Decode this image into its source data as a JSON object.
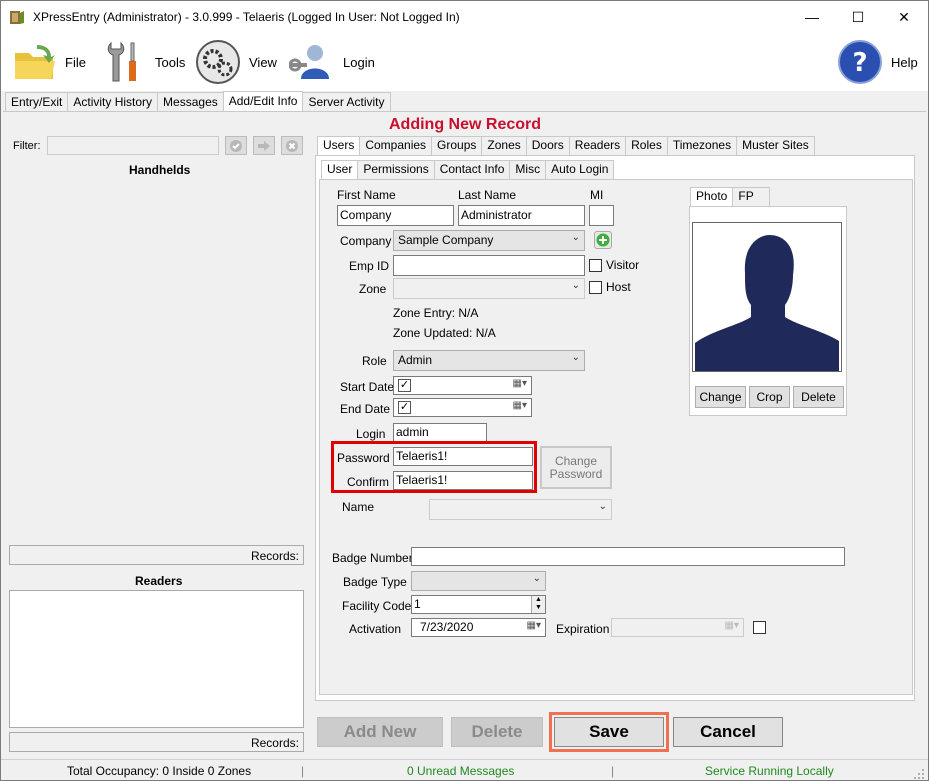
{
  "window": {
    "title": "XPressEntry (Administrator)  - 3.0.999 - Telaeris (Logged In User: Not Logged In)",
    "minimize": "—",
    "maximize": "☐",
    "close": "✕"
  },
  "toolbar": {
    "file": "File",
    "tools": "Tools",
    "view": "View",
    "login": "Login",
    "help": "Help"
  },
  "main_tabs": [
    "Entry/Exit",
    "Activity History",
    "Messages",
    "Add/Edit Info",
    "Server Activity"
  ],
  "left": {
    "filter_label": "Filter:",
    "filter_value": "",
    "handhelds_title": "Handhelds",
    "records_label_1": "Records:",
    "readers_title": "Readers",
    "records_label_2": "Records:"
  },
  "heading": "Adding New Record",
  "record_tabs": [
    "Users",
    "Companies",
    "Groups",
    "Zones",
    "Doors",
    "Readers",
    "Roles",
    "Timezones",
    "Muster Sites"
  ],
  "user_tabs": [
    "User",
    "Permissions",
    "Contact Info",
    "Misc",
    "Auto Login"
  ],
  "photo_tabs": [
    "Photo",
    "FP"
  ],
  "form": {
    "first_name_label": "First Name",
    "last_name_label": "Last Name",
    "mi_label": "MI",
    "first_name": "Company",
    "last_name": "Administrator",
    "mi": "",
    "company_label": "Company",
    "company": "Sample Company",
    "emp_id_label": "Emp ID",
    "emp_id": "",
    "visitor_label": "Visitor",
    "zone_label": "Zone",
    "zone": "",
    "host_label": "Host",
    "zone_entry": "Zone Entry: N/A",
    "zone_updated": "Zone Updated: N/A",
    "role_label": "Role",
    "role": "Admin",
    "start_date_label": "Start Date",
    "end_date_label": "End Date",
    "login_label": "Login",
    "login": "admin",
    "password_label": "Password",
    "password": "Telaeris1!",
    "confirm_label": "Confirm",
    "confirm": "Telaeris1!",
    "change_password": "Change Password",
    "name_label": "Name",
    "name": "",
    "badge_number_label": "Badge Number",
    "badge_number": "",
    "badge_type_label": "Badge Type",
    "badge_type": "",
    "facility_code_label": "Facility Code",
    "facility_code": "1",
    "activation_label": "Activation",
    "activation": "7/23/2020",
    "expiration_label": "Expiration",
    "expiration": ""
  },
  "photo_buttons": {
    "change": "Change",
    "crop": "Crop",
    "delete": "Delete"
  },
  "actions": {
    "add_new": "Add New",
    "delete": "Delete",
    "save": "Save",
    "cancel": "Cancel"
  },
  "status": {
    "occupancy": "Total Occupancy: 0 Inside 0 Zones",
    "sep1": "|",
    "messages": "0 Unread Messages",
    "sep2": "|",
    "service": "Service Running Locally"
  },
  "colors": {
    "heading": "#c8102e",
    "highlight": "#e00000",
    "save_highlight": "#f07050",
    "status_green": "#1e8a1e",
    "silhouette": "#1f2a5a"
  }
}
